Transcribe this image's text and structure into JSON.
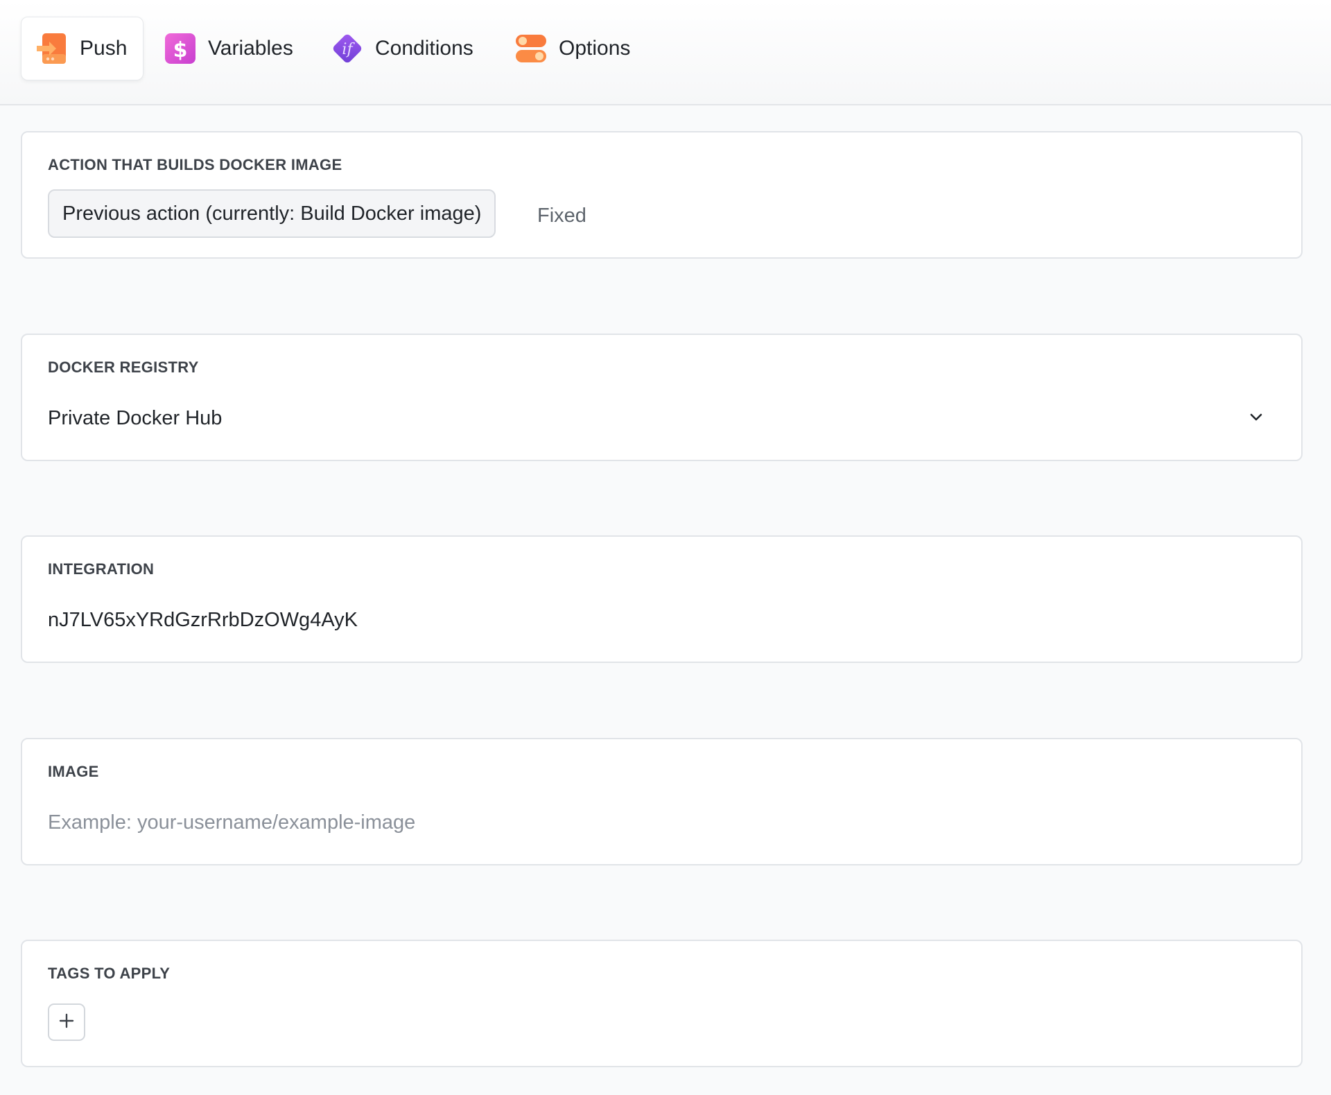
{
  "tabs": [
    {
      "label": "Push",
      "icon": "push-icon",
      "active": true
    },
    {
      "label": "Variables",
      "icon": "dollar-icon",
      "active": false
    },
    {
      "label": "Conditions",
      "icon": "if-icon",
      "active": false
    },
    {
      "label": "Options",
      "icon": "toggle-options-icon",
      "active": false
    }
  ],
  "action_card": {
    "label": "ACTION THAT BUILDS DOCKER IMAGE",
    "selected": "Previous action (currently: Build Docker image)",
    "mode": "Fixed"
  },
  "registry_card": {
    "label": "DOCKER REGISTRY",
    "selected": "Private Docker Hub",
    "icon": "chevron-down-icon"
  },
  "integration_card": {
    "label": "INTEGRATION",
    "value": "nJ7LV65xYRdGzrRrbDzOWg4AyK"
  },
  "image_card": {
    "label": "IMAGE",
    "placeholder": "Example: your-username/example-image"
  },
  "tags_card": {
    "label": "TAGS TO APPLY",
    "add_icon": "plus-icon"
  },
  "colors": {
    "accent_orange": "#f97b3d",
    "accent_pink": "#e052c8",
    "accent_purple": "#8b4fe0",
    "border": "#e1e4e8",
    "background": "#f9fafb"
  }
}
